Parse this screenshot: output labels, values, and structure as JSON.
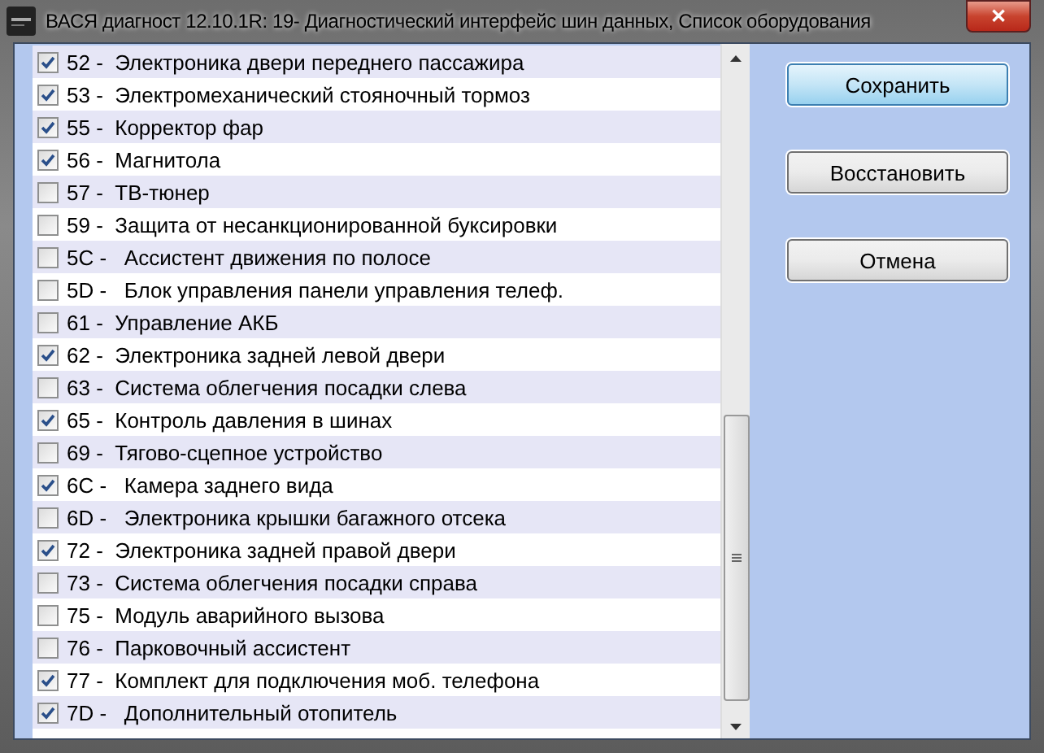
{
  "window": {
    "title": "ВАСЯ диагност 12.10.1R: 19- Диагностический интерфейс шин данных,  Список оборудования",
    "close_label": "✕"
  },
  "list": [
    {
      "label": "52 -  Электроника двери переднего пассажира",
      "checked": true
    },
    {
      "label": "53 -  Электромеханический стояночный тормоз",
      "checked": true
    },
    {
      "label": "55 -  Корректор фар",
      "checked": true
    },
    {
      "label": "56 -  Магнитола",
      "checked": true
    },
    {
      "label": "57 -  ТВ-тюнер",
      "checked": false
    },
    {
      "label": "59 -  Защита от несанкционированной буксировки",
      "checked": false
    },
    {
      "label": "5C -   Ассистент движения по полосе",
      "checked": false
    },
    {
      "label": "5D -   Блок управления панели управления телеф.",
      "checked": false
    },
    {
      "label": "61 -  Управление АКБ",
      "checked": false
    },
    {
      "label": "62 -  Электроника задней левой двери",
      "checked": true
    },
    {
      "label": "63 -  Система облегчения посадки слева",
      "checked": false
    },
    {
      "label": "65 -  Контроль давления в шинах",
      "checked": true
    },
    {
      "label": "69 -  Тягово-сцепное устройство",
      "checked": false
    },
    {
      "label": "6C -   Камера заднего вида",
      "checked": true
    },
    {
      "label": "6D -   Электроника крышки багажного отсека",
      "checked": false
    },
    {
      "label": "72 -  Электроника задней правой двери",
      "checked": true
    },
    {
      "label": "73 -  Система облегчения посадки справа",
      "checked": false
    },
    {
      "label": "75 -  Модуль аварийного вызова",
      "checked": false
    },
    {
      "label": "76 -  Парковочный ассистент",
      "checked": false
    },
    {
      "label": "77 -  Комплект для подключения моб. телефона",
      "checked": true
    },
    {
      "label": "7D -   Дополнительный отопитель",
      "checked": true
    }
  ],
  "buttons": [
    {
      "label": "Сохранить",
      "selected": true
    },
    {
      "label": "Восстановить",
      "selected": false
    },
    {
      "label": "Отмена",
      "selected": false
    }
  ]
}
